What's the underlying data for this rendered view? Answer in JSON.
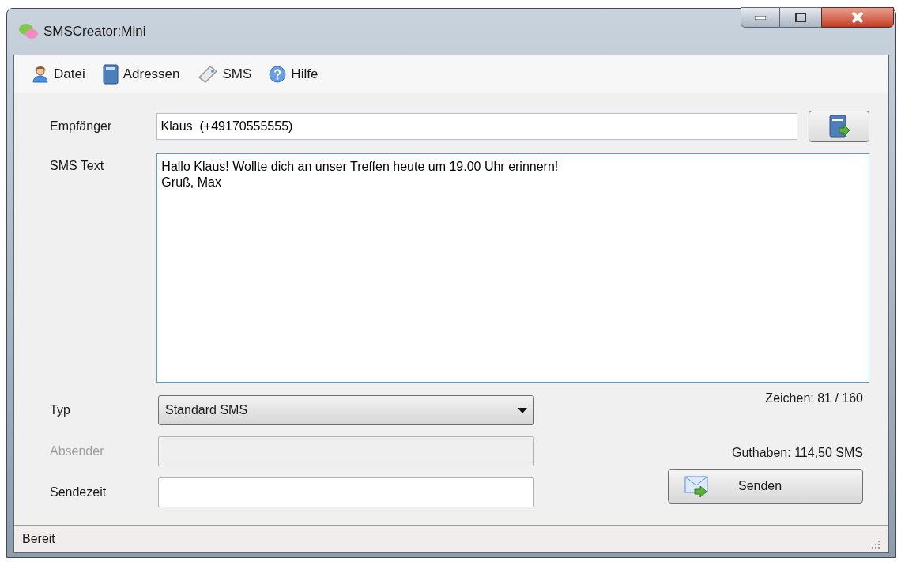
{
  "window": {
    "title": "SMSCreator:Mini"
  },
  "menu": [
    {
      "label": "Datei"
    },
    {
      "label": "Adressen"
    },
    {
      "label": "SMS"
    },
    {
      "label": "Hilfe"
    }
  ],
  "recipient": {
    "label": "Empfänger",
    "value": "Klaus  (+49170555555)"
  },
  "sms_text": {
    "label": "SMS Text",
    "value": "Hallo Klaus! Wollte dich an unser Treffen heute um 19.00 Uhr erinnern!\nGruß, Max"
  },
  "char_count": "Zeichen: 81 / 160",
  "fields": [
    {
      "kind": "dropdown",
      "label": "Typ",
      "value": "Standard SMS",
      "disabled": false
    },
    {
      "kind": "text",
      "label": "Absender",
      "disabled": true
    },
    {
      "kind": "text",
      "label": "Sendezeit",
      "disabled": false
    }
  ],
  "balance": "Guthaben: 114,50 SMS",
  "send_button": "Senden",
  "status_bar": "Bereit"
}
